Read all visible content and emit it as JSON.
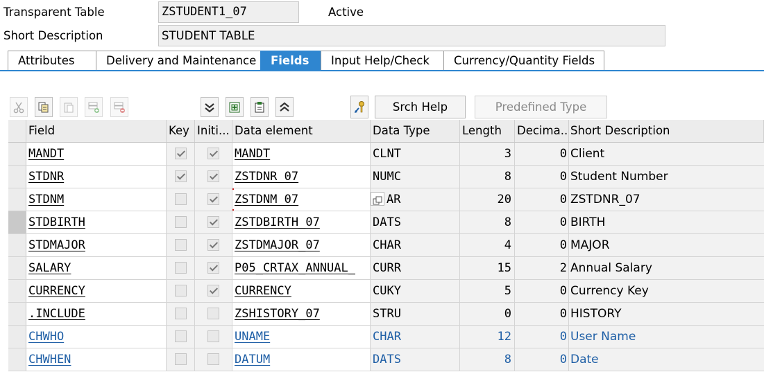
{
  "header": {
    "table_label": "Transparent Table",
    "table_name": "ZSTUDENT1_07",
    "status": "Active",
    "desc_label": "Short Description",
    "desc_value": "STUDENT TABLE"
  },
  "tabs": [
    {
      "label": "Attributes",
      "active": false
    },
    {
      "label": "Delivery and Maintenance",
      "active": false
    },
    {
      "label": "Fields",
      "active": true
    },
    {
      "label": "Input Help/Check",
      "active": false
    },
    {
      "label": "Currency/Quantity Fields",
      "active": false
    }
  ],
  "toolbar": {
    "icons": [
      "scissors-icon",
      "copy-icon",
      "paste-icon",
      "insert-row-icon",
      "delete-row-icon",
      "scroll-down-icon",
      "insert-icon",
      "view-icon",
      "scroll-up-icon",
      "key-icon"
    ],
    "srch_help": "Srch Help",
    "predefined_type": "Predefined Type"
  },
  "columns": [
    "Field",
    "Key",
    "Initi...",
    "Data element",
    "Data Type",
    "Length",
    "Decima...",
    "Short Description"
  ],
  "rows": [
    {
      "field": "MANDT",
      "key": true,
      "init": true,
      "de": "MANDT",
      "dt": "CLNT",
      "len": "3",
      "dec": "0",
      "desc": "Client",
      "inc": false
    },
    {
      "field": "STDNR",
      "key": true,
      "init": true,
      "de": "ZSTDNR_07",
      "dt": "NUMC",
      "len": "8",
      "dec": "0",
      "desc": "Student Number",
      "inc": false
    },
    {
      "field": "STDNM",
      "key": false,
      "init": true,
      "de": "ZSTDNM_07",
      "dt": "AR",
      "len": "20",
      "dec": "0",
      "desc": "ZSTDNR_07",
      "inc": false
    },
    {
      "field": "STDBIRTH",
      "key": false,
      "init": true,
      "de": "ZSTDBIRTH_07",
      "dt": "DATS",
      "len": "8",
      "dec": "0",
      "desc": "BIRTH",
      "inc": false
    },
    {
      "field": "STDMAJOR",
      "key": false,
      "init": true,
      "de": "ZSTDMAJOR_07",
      "dt": "CHAR",
      "len": "4",
      "dec": "0",
      "desc": "MAJOR",
      "inc": false
    },
    {
      "field": "SALARY",
      "key": false,
      "init": true,
      "de": "P05_CRTAX_ANNUAL_",
      "dt": "CURR",
      "len": "15",
      "dec": "2",
      "desc": "Annual Salary",
      "inc": false
    },
    {
      "field": "CURRENCY",
      "key": false,
      "init": true,
      "de": "CURRENCY",
      "dt": "CUKY",
      "len": "5",
      "dec": "0",
      "desc": "Currency Key",
      "inc": false
    },
    {
      "field": ".INCLUDE",
      "key": false,
      "init": false,
      "de": "ZSHISTORY_07",
      "dt": "STRU",
      "len": "0",
      "dec": "0",
      "desc": "HISTORY",
      "inc": false
    },
    {
      "field": "CHWHO",
      "key": false,
      "init": false,
      "de": "UNAME",
      "dt": "CHAR",
      "len": "12",
      "dec": "0",
      "desc": "User Name",
      "inc": true
    },
    {
      "field": "CHWHEN",
      "key": false,
      "init": false,
      "de": "DATUM",
      "dt": "DATS",
      "len": "8",
      "dec": "0",
      "desc": "Date",
      "inc": true
    }
  ],
  "colors": {
    "accent": "#2f86d0",
    "include_text": "#1f5fa6"
  }
}
